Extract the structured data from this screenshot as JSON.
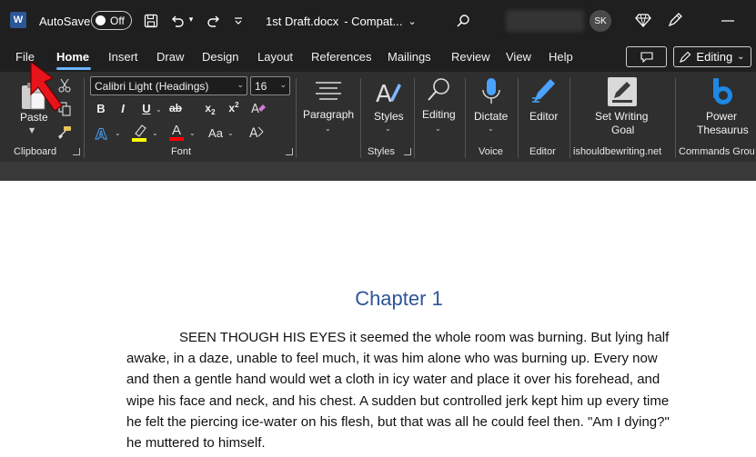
{
  "titlebar": {
    "app_logo": "W",
    "autosave_label": "AutoSave",
    "autosave_state": "Off",
    "document_title": "1st Draft.docx",
    "compat": "- Compat...",
    "user_initials": "SK"
  },
  "tabs": {
    "file": "File",
    "home": "Home",
    "insert": "Insert",
    "draw": "Draw",
    "design": "Design",
    "layout": "Layout",
    "references": "References",
    "mailings": "Mailings",
    "review": "Review",
    "view": "View",
    "help": "Help",
    "editing_mode": "Editing"
  },
  "ribbon": {
    "paste": "Paste",
    "clipboard": "Clipboard",
    "font_name": "Calibri Light (Headings)",
    "font_size": "16",
    "bold": "B",
    "italic": "I",
    "underline": "U",
    "strikethrough": "ab",
    "subscript": "x",
    "superscript": "x",
    "font_color_letter": "A",
    "change_case": "Aa",
    "font_group": "Font",
    "paragraph": "Paragraph",
    "styles": "Styles",
    "styles_group": "Styles",
    "editing": "Editing",
    "dictate": "Dictate",
    "voice_group": "Voice",
    "editor": "Editor",
    "editor_group": "Editor",
    "set_writing_goal_1": "Set Writing",
    "set_writing_goal_2": "Goal",
    "addin_group": "ishouldbewriting.net",
    "power_thesaurus_1": "Power",
    "power_thesaurus_2": "Thesaurus",
    "commands_group": "Commands Grou"
  },
  "document": {
    "heading": "Chapter 1",
    "paragraph": "SEEN THOUGH HIS EYES it seemed the whole room was burning. But lying half awake, in a daze, unable to feel much, it was him alone who was burning up. Every now and then a gentle hand would wet a cloth in icy water and place it over his forehead, and wipe his face and neck, and his chest. A sudden but controlled jerk kept him up every time he felt the piercing ice-water on his flesh, but that was all he could feel then. \"Am I dying?\" he muttered to himself."
  },
  "colors": {
    "titlebar_bg": "#1f1f1f",
    "ribbon_bg": "#2f2f2f",
    "heading": "#2f5496",
    "tab_underline": "#6cb4ff",
    "arrow": "#e8141b",
    "highlight_yellow": "#ffff00",
    "font_color_red": "#ff0000",
    "text_effects_blue": "#4aa3ff"
  },
  "icons": [
    "word-logo-icon",
    "save-icon",
    "undo-icon",
    "redo-icon",
    "customize-qat-icon",
    "search-icon",
    "premium-diamond-icon",
    "pen-icon",
    "minimize-icon",
    "comment-icon",
    "cut-icon",
    "copy-icon",
    "format-painter-icon",
    "clear-formatting-icon",
    "text-effects-icon",
    "highlighter-icon",
    "paragraph-icon",
    "styles-icon",
    "find-icon",
    "microphone-icon",
    "editor-pen-icon",
    "writing-goal-icon",
    "power-thesaurus-icon"
  ]
}
